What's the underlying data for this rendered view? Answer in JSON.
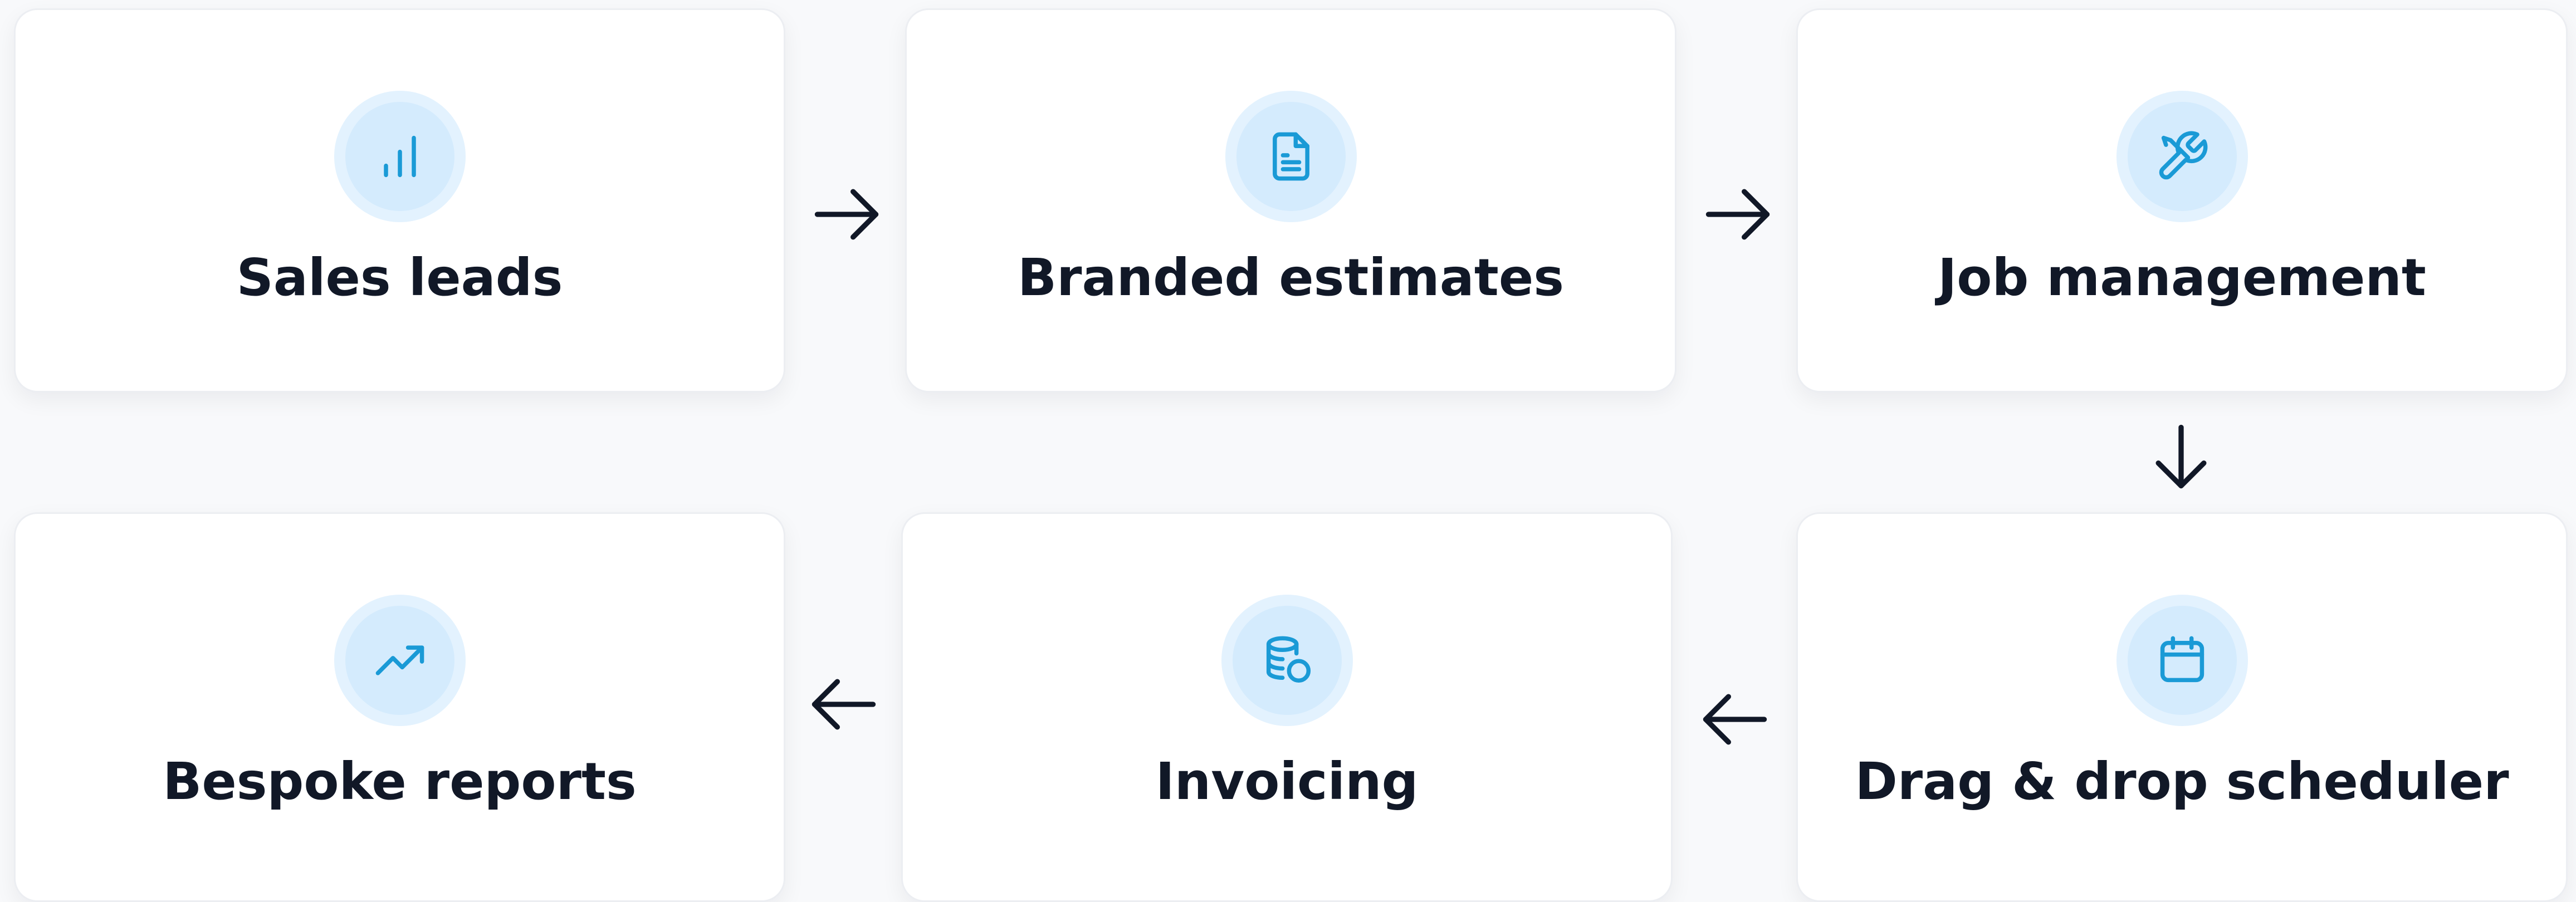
{
  "colors": {
    "page_background": "#f8f9fb",
    "card_background": "#ffffff",
    "icon_accent": "#1a9ad6",
    "icon_circle_outer": "#e3f2fe",
    "icon_circle_inner": "#d4ebfd",
    "label_text": "#111827",
    "arrow": "#111827"
  },
  "steps": [
    {
      "label": "Sales leads",
      "icon": "bar-chart-icon"
    },
    {
      "label": "Branded estimates",
      "icon": "document-icon"
    },
    {
      "label": "Job management",
      "icon": "wrench-screwdriver-icon"
    },
    {
      "label": "Drag & drop scheduler",
      "icon": "calendar-icon"
    },
    {
      "label": "Invoicing",
      "icon": "coins-icon"
    },
    {
      "label": "Bespoke reports",
      "icon": "trending-up-icon"
    }
  ],
  "connectors": [
    {
      "from": "Sales leads",
      "to": "Branded estimates",
      "direction": "right"
    },
    {
      "from": "Branded estimates",
      "to": "Job management",
      "direction": "right"
    },
    {
      "from": "Job management",
      "to": "Drag & drop scheduler",
      "direction": "down"
    },
    {
      "from": "Drag & drop scheduler",
      "to": "Invoicing",
      "direction": "left"
    },
    {
      "from": "Invoicing",
      "to": "Bespoke reports",
      "direction": "left"
    }
  ]
}
